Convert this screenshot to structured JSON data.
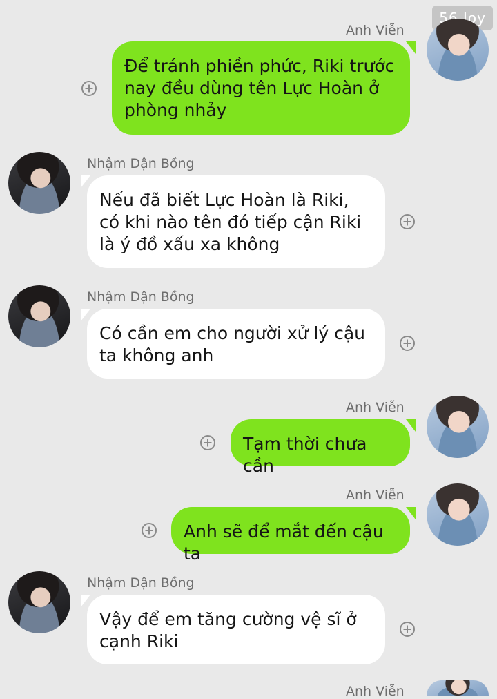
{
  "watermark": "56 Joy",
  "messages": [
    {
      "sender": "Anh Viễn",
      "side": "right",
      "text": "Để tránh phiền phức, Riki trước nay đều dùng tên Lực Hoàn ở phòng nhảy"
    },
    {
      "sender": "Nhậm Dận Bồng",
      "side": "left",
      "text": "Nếu đã biết Lực Hoàn là Riki, có khi nào tên đó tiếp cận Riki là ý đồ xấu xa không"
    },
    {
      "sender": "Nhậm Dận Bồng",
      "side": "left",
      "text": "Có cần em cho người xử lý cậu ta không anh"
    },
    {
      "sender": "Anh Viễn",
      "side": "right",
      "text": "Tạm thời chưa cần"
    },
    {
      "sender": "Anh Viễn",
      "side": "right",
      "text": "Anh sẽ để mắt đến cậu ta"
    },
    {
      "sender": "Nhậm Dận Bồng",
      "side": "left",
      "text": "Vậy để em tăng cường vệ sĩ ở cạnh Riki"
    },
    {
      "sender": "Anh Viễn",
      "side": "right",
      "text": ""
    }
  ],
  "colors": {
    "background": "#e9e9e9",
    "outgoing_bubble": "#7fe31e",
    "incoming_bubble": "#ffffff",
    "sender_name": "#6d6d6d"
  }
}
